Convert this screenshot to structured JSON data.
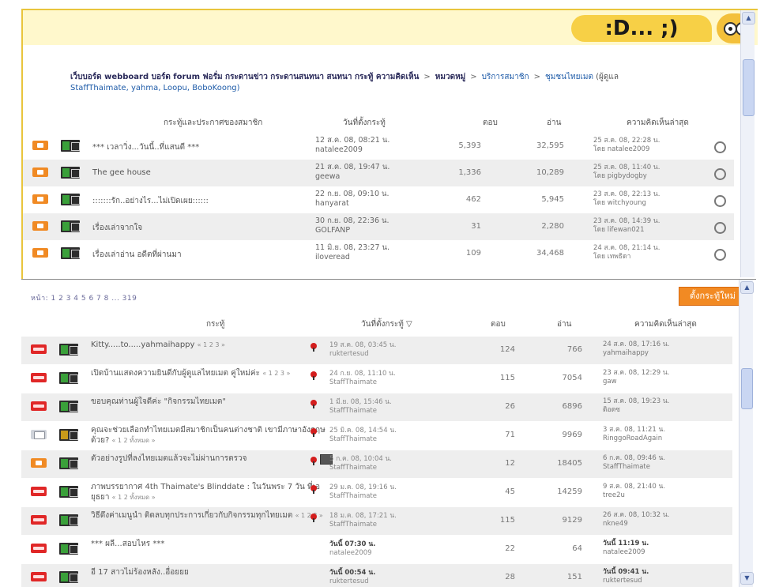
{
  "banner": {
    "bubble_text": ":D... ;)",
    "mascot_icon": "smiley-mascot-icon"
  },
  "breadcrumb": {
    "prefix": "เว็บบอร์ด webboard บอร์ด forum ฟอรั่ม กระดานข่าว กระดานสนทนา สนทนา กระทู้ ความคิดเห็น",
    "items": [
      "หมวดหมู่",
      "บริการสมาชิก",
      "ชุมชนไทยเมต"
    ],
    "moderators_suffix": "(ผู้ดูแล",
    "moderators": "StaffThaimate, yahma, Loopu, BoboKoong)"
  },
  "subforum_header": [
    "กระทู้และประกาศของสมาชิก",
    "วันที่ตั้งกระทู้",
    "ตอบ",
    "อ่าน",
    "ความคิดเห็นล่าสุด"
  ],
  "subforums": [
    {
      "title": "*** เวลาวิ่ง...วันนี้..ที่แสนดี ***",
      "started": "12 ส.ค. 08, 08:21 น.",
      "starter": "natalee2009",
      "replies": "5,393",
      "views": "32,595",
      "last_time": "25 ส.ค. 08, 22:28 น.",
      "last_by": "โดย natalee2009"
    },
    {
      "title": "The gee house",
      "started": "21 ส.ค. 08, 19:47 น.",
      "starter": "geewa",
      "replies": "1,336",
      "views": "10,289",
      "last_time": "25 ส.ค. 08, 11:40 น.",
      "last_by": "โดย pigbydogby"
    },
    {
      "title": ":::::::รัก..อย่างไร...ไม่เปิดเผย::::::",
      "started": "22 ก.ย. 08, 09:10 น.",
      "starter": "hanyarat",
      "replies": "462",
      "views": "5,945",
      "last_time": "23 ส.ค. 08, 22:13 น.",
      "last_by": "โดย witchyoung"
    },
    {
      "title": "เรื่องเล่าจากใจ",
      "started": "30 ก.ย. 08, 22:36 น.",
      "starter": "GOLFANP",
      "replies": "31",
      "views": "2,280",
      "last_time": "23 ส.ค. 08, 14:39 น.",
      "last_by": "โดย lifewan021"
    },
    {
      "title": "เรื่องเล่าอ่าน อดีตที่ผ่านมา",
      "started": "11 มิ.ย. 08, 23:27 น.",
      "starter": "iloveread",
      "replies": "109",
      "views": "34,468",
      "last_time": "24 ส.ค. 08, 21:14 น.",
      "last_by": "โดย เทพธิดา"
    }
  ],
  "pagination": "หน้า: 1 2 3 4 5 6 7 8 ... 319",
  "new_topic_label": "ตั้งกระทู้ใหม่",
  "topic_header": [
    "กระทู้",
    "วันที่ตั้งกระทู้ ▽",
    "ตอบ",
    "อ่าน",
    "ความคิดเห็นล่าสุด"
  ],
  "topics": [
    {
      "icon": "hot-topic-icon",
      "title": "Kitty.....to.....yahmaihappy",
      "pages": "« 1 2 3 »",
      "started": "19 ส.ค. 08, 03:45 น.",
      "starter": "ruktertesud",
      "replies": "124",
      "views": "766",
      "last_time": "24 ส.ค. 08, 17:16 น.",
      "last_by": "yahmaihappy"
    },
    {
      "icon": "hot-topic-icon",
      "title": "เปิดบ้านแสดงความยินดีกับผู้ดูแลไทยเมต คู่ใหม่ค่ะ",
      "pages": "« 1 2 3 »",
      "started": "24 ก.ย. 08, 11:10 น.",
      "starter": "StaffThaimate",
      "replies": "115",
      "views": "7054",
      "last_time": "23 ส.ค. 08, 12:29 น.",
      "last_by": "gaw"
    },
    {
      "icon": "hot-topic-icon",
      "title": "ขอบคุณท่านผู้ใจดีค่ะ \"กิจกรรมไทยเมต\"",
      "pages": "",
      "started": "1 มี.ย. 08, 15:46 น.",
      "starter": "StaffThaimate",
      "replies": "26",
      "views": "6896",
      "last_time": "15 ส.ค. 08, 19:23 น.",
      "last_by": "ดิอดซ"
    },
    {
      "icon": "poll-topic-icon",
      "title": "คุณจะช่วยเลือกทำไทยเมตมีสมาชิกเป็นคนต่างชาติ เขามีภาษาอังกฤษด้วย?",
      "pages": "« 1 2 ทั้งหมด »",
      "started": "25 มิ.ค. 08, 14:54 น.",
      "starter": "StaffThaimate",
      "replies": "71",
      "views": "9969",
      "last_time": "3 ส.ค. 08, 11:21 น.",
      "last_by": "RinggoRoadAgain"
    },
    {
      "icon": "topic-icon",
      "title": "ตัวอย่างรูปที่ลงไทยเมตแล้วจะไม่ผ่านการตรวจ",
      "pages": "",
      "started": "5 ก.ค. 08, 10:04 น.",
      "starter": "StaffThaimate",
      "replies": "12",
      "views": "18405",
      "last_time": "6 ก.ค. 08, 09:46 น.",
      "last_by": "StaffThaimate"
    },
    {
      "icon": "hot-topic-icon",
      "title": "ภาพบรรยากาศ 4th Thaimate's Blinddate : ในวันพระ 7 วัน ที่เอยุธยา",
      "pages": "« 1 2 ทั้งหมด »",
      "started": "29 ม.ค. 08, 19:16 น.",
      "starter": "StaffThaimate",
      "replies": "45",
      "views": "14259",
      "last_time": "9 ส.ค. 08, 21:40 น.",
      "last_by": "tree2u"
    },
    {
      "icon": "hot-topic-icon",
      "title": "วิธีดึงค่าเมนูนำ ติดลบทุกประการเกี่ยวกับกิจกรรมทุกไทยเมต",
      "pages": "« 1 2 3 »",
      "started": "18 ม.ค. 08, 17:21 น.",
      "starter": "StaffThaimate",
      "replies": "115",
      "views": "9129",
      "last_time": "26 ส.ค. 08, 10:32 น.",
      "last_by": "nkne49"
    },
    {
      "icon": "hot-topic-icon",
      "title": "*** ผลี...สอบไหร ***",
      "pages": "",
      "started": "วันนี้ 07:30 น.",
      "starter": "natalee2009",
      "replies": "22",
      "views": "64",
      "last_time": "วันนี้ 11:19 น.",
      "last_by": "natalee2009"
    },
    {
      "icon": "hot-topic-icon",
      "title": "อี 17 สาวไม่ร้องหลัง..อื่อยยย",
      "pages": "",
      "started": "วันนี้ 00:54 น.",
      "starter": "ruktertesud",
      "replies": "28",
      "views": "151",
      "last_time": "วันนี้ 09:41 น.",
      "last_by": "ruktertesud"
    }
  ]
}
